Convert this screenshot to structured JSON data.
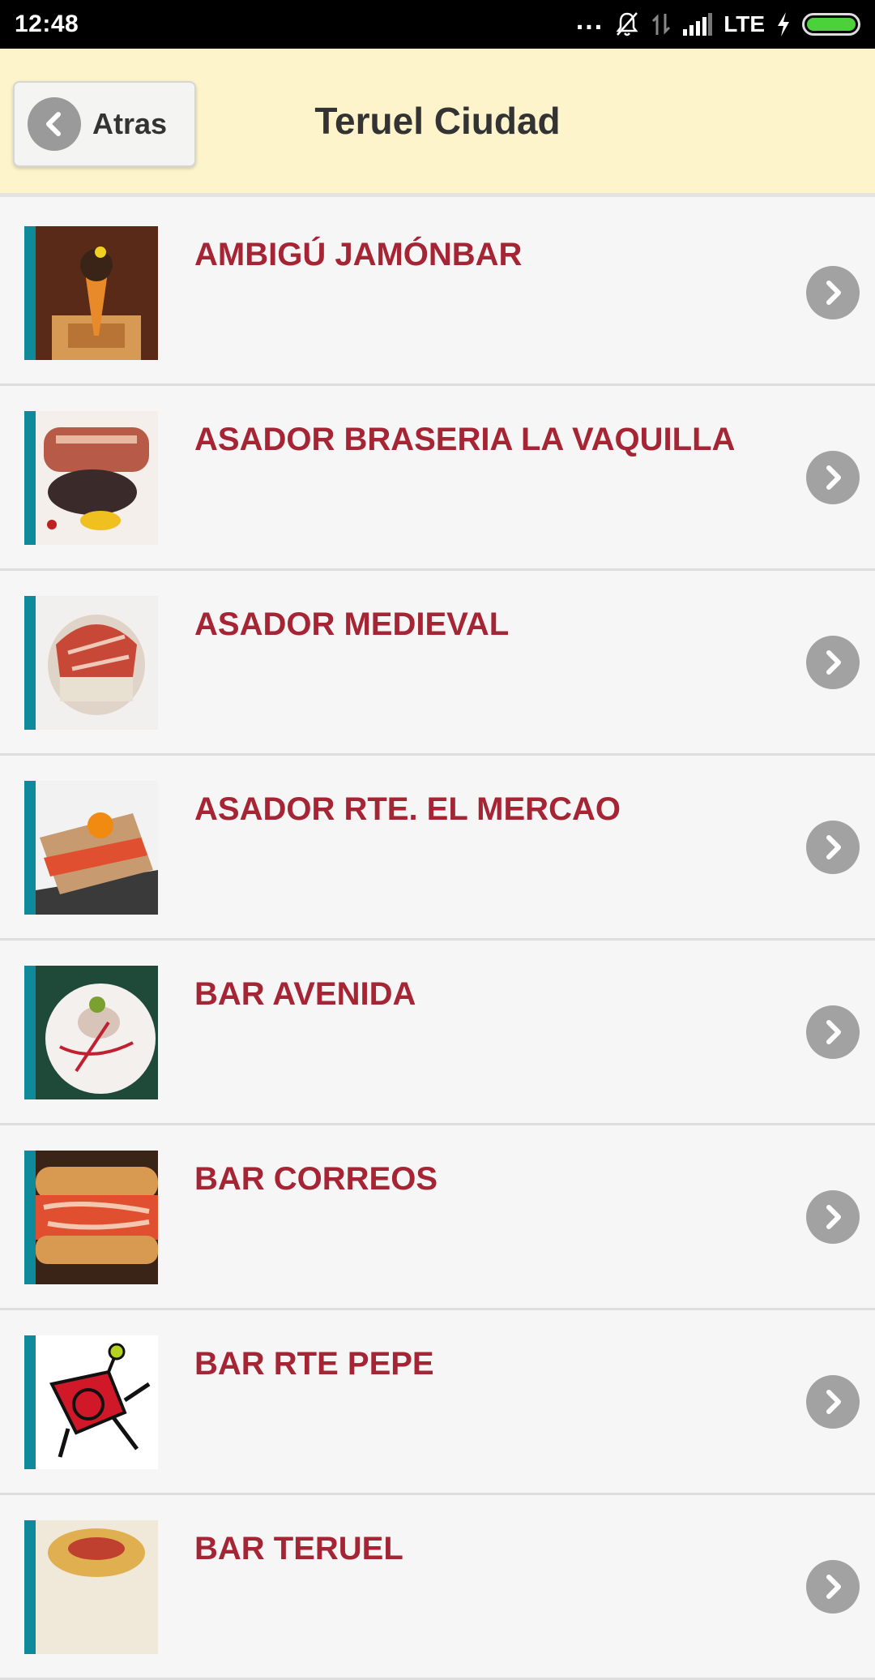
{
  "status_bar": {
    "time": "12:48",
    "dots": "...",
    "network": "LTE",
    "icons": [
      "mute-bell-icon",
      "data-arrows-icon",
      "signal-icon",
      "charging-bolt-icon",
      "battery-icon"
    ]
  },
  "header": {
    "back_label": "Atras",
    "title": "Teruel Ciudad"
  },
  "list": {
    "items": [
      {
        "title": "AMBIGÚ JAMÓNBAR"
      },
      {
        "title": "ASADOR BRASERIA LA VAQUILLA"
      },
      {
        "title": "ASADOR MEDIEVAL"
      },
      {
        "title": "ASADOR RTE. EL MERCAO"
      },
      {
        "title": "BAR AVENIDA"
      },
      {
        "title": "BAR CORREOS"
      },
      {
        "title": "BAR RTE PEPE"
      },
      {
        "title": "BAR TERUEL"
      }
    ]
  },
  "colors": {
    "header_bg": "#fdf4cc",
    "title_red": "#a52535",
    "accent_teal": "#0f8a9a",
    "chevron_grey": "#a2a2a2"
  }
}
